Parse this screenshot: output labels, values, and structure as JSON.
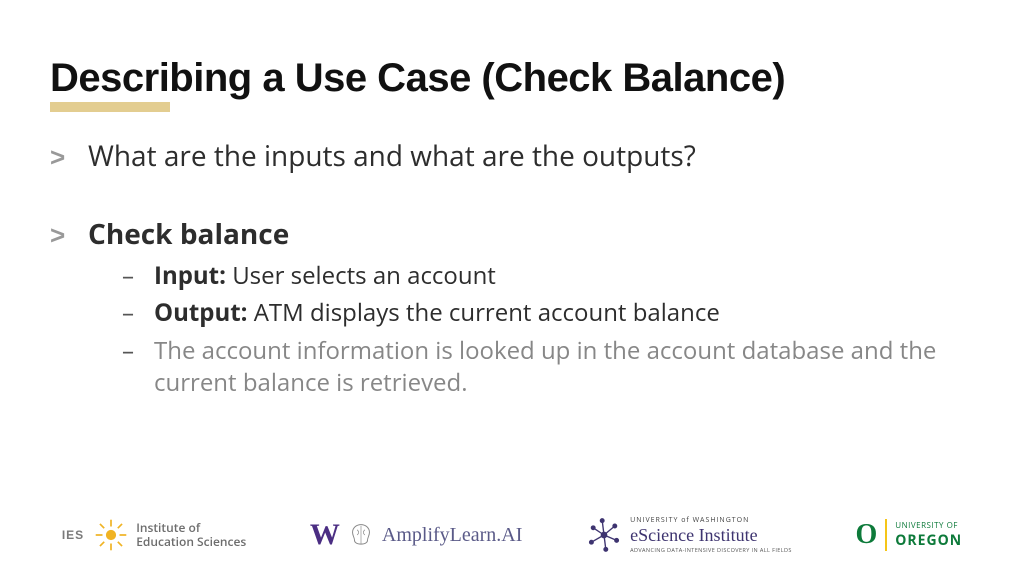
{
  "title": "Describing a Use Case (Check Balance)",
  "bullets": {
    "q": "What are the inputs and what are the outputs?",
    "heading": "Check balance",
    "sub": {
      "input_label": "Input:",
      "input_text": " User selects an account",
      "output_label": "Output:",
      "output_text": " ATM displays the current account balance",
      "note": "The account information is looked up in the account database and the current balance is retrieved."
    }
  },
  "logos": {
    "ies_tag": "IES",
    "ies": "Institute of\nEducation Sciences",
    "uw": "W",
    "amplify": "AmplifyLearn.AI",
    "esci_top": "UNIVERSITY of WASHINGTON",
    "esci_mid": "eScience Institute",
    "esci_bot": "ADVANCING DATA-INTENSIVE DISCOVERY IN ALL FIELDS",
    "uo_o": "O",
    "uo_top": "UNIVERSITY OF",
    "uo_bot": "OREGON"
  }
}
